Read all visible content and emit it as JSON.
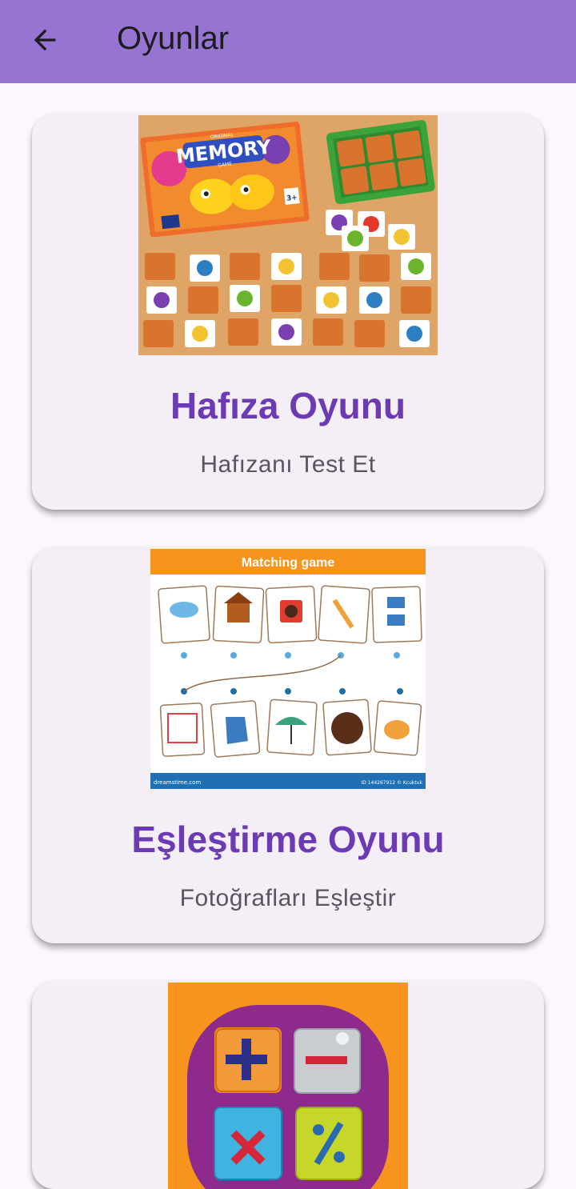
{
  "appbar": {
    "title": "Oyunlar",
    "back_icon": "arrow-back-icon",
    "color": "#9575d1"
  },
  "games": [
    {
      "title": "Hafıza Oyunu",
      "subtitle": "Hafızanı Test Et",
      "image": "memory-game-box-image",
      "image_text": [
        "ORIGINAL",
        "MEMORY",
        "GAME",
        "3+"
      ]
    },
    {
      "title": "Eşleştirme Oyunu",
      "subtitle": "Fotoğrafları Eşleştir",
      "image": "matching-game-image",
      "image_text": [
        "Matching game",
        "dreamstime.com",
        "ID 144267912 © Kcuktuk"
      ]
    },
    {
      "image": "math-operations-image"
    }
  ],
  "colors": {
    "title": "#6c3bb3",
    "card": "#f4eff7",
    "background": "#fcf6fd"
  }
}
